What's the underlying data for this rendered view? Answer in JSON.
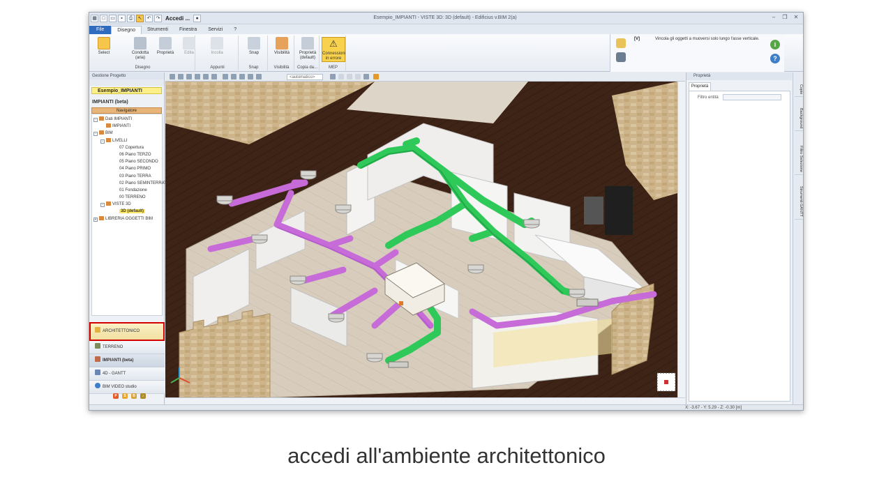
{
  "window": {
    "title": "Esempio_IMPIANTI - VISTE 3D: 3D (default) - Edificius v.BIM 2(a)",
    "qat_label": "Accedi ..."
  },
  "tabs": [
    "File",
    "Disegno",
    "Strumenti",
    "Finestra",
    "Servizi",
    "?"
  ],
  "ribbon": {
    "buttons": {
      "select": "Select",
      "condotta": "Condotta (aria)",
      "proprieta": "Proprietà",
      "edita": "Edita",
      "incolla": "Incolla",
      "snap": "Snap",
      "visibilita": "Visibilità",
      "proprieta_default": "Proprietà (default)",
      "connessioni": "Connessioni in errore"
    },
    "groups": {
      "disegno": "Disegno",
      "appunti": "Appunti",
      "snap": "Snap",
      "visibilita": "Visibilità",
      "copia": "Copia da...",
      "mep": "MEP"
    }
  },
  "message": {
    "tag": "[V]",
    "text": "Vincola gli oggetti a muoversi solo lungo l'asse verticale."
  },
  "left_panel": {
    "header": "Gestione Progetto",
    "project": "Esempio_IMPIANTI",
    "environment": "IMPIANTI (beta)",
    "navigator": "Navigatore",
    "tree": [
      {
        "label": "Dati IMPIANTI",
        "indent": 0,
        "toggle": "-"
      },
      {
        "label": "IMPIANTI",
        "indent": 1,
        "toggle": ""
      },
      {
        "label": "BIM",
        "indent": 0,
        "toggle": "-"
      },
      {
        "label": "LIVELLI",
        "indent": 1,
        "toggle": "-"
      },
      {
        "label": "07 Copertura",
        "indent": 2,
        "toggle": ""
      },
      {
        "label": "06 Piano TERZO",
        "indent": 2,
        "toggle": ""
      },
      {
        "label": "05 Piano SECONDO",
        "indent": 2,
        "toggle": ""
      },
      {
        "label": "04 Piano PRIMO",
        "indent": 2,
        "toggle": ""
      },
      {
        "label": "03 Piano TERRA",
        "indent": 2,
        "toggle": ""
      },
      {
        "label": "02 Piano SEMINTERRATO",
        "indent": 2,
        "toggle": ""
      },
      {
        "label": "01 Fondazione",
        "indent": 2,
        "toggle": ""
      },
      {
        "label": "00 TERRENO",
        "indent": 2,
        "toggle": ""
      },
      {
        "label": "VISTE 3D",
        "indent": 1,
        "toggle": "-"
      },
      {
        "label": "3D (default)",
        "indent": 2,
        "toggle": "",
        "selected": true
      },
      {
        "label": "LIBRERIA OGGETTI BIM",
        "indent": 0,
        "toggle": "+"
      }
    ],
    "environments": [
      "ARCHITETTONICO",
      "TERRENO",
      "IMPIANTI (beta)",
      "4D - GANTT",
      "BIM VIDEO studio"
    ]
  },
  "viewbar": {
    "mode": "<automatico>"
  },
  "right_panel": {
    "header": "Proprietà",
    "tab": "Proprietà",
    "filter_label": "Filtro entità"
  },
  "side_tabs": [
    "Copie",
    "Background",
    "Filtro Selezione",
    "Strumenti GANTT"
  ],
  "status": {
    "coords": "X: -3.67 - Y: 5.29 - Z: -0.30 [m]"
  },
  "caption": "accedi all'ambiente architettonico",
  "colors": {
    "supply_duct": "#2fc95a",
    "return_duct": "#c76bd9",
    "accent": "#2f6bbf",
    "highlight": "#d40000"
  }
}
